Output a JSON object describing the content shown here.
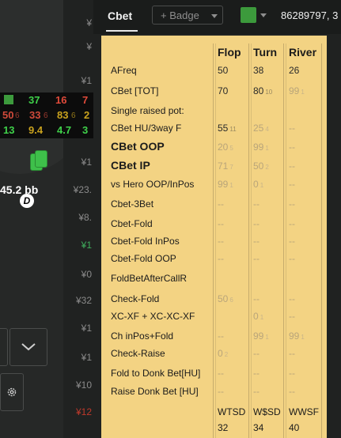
{
  "header": {
    "tab_label": "Cbet",
    "badge_label": "+ Badge",
    "player_color": "#3c9a3c",
    "player_id_text": "86289797, 3"
  },
  "background": {
    "right_values": [
      "¥",
      "¥",
      "¥1",
      "¥",
      "¥1",
      "¥23.",
      "¥8.",
      "¥1",
      "¥0",
      "¥32",
      "¥1",
      "¥1",
      "¥10",
      "¥12"
    ],
    "hud_row1": [
      "37",
      "16",
      "7"
    ],
    "hud_row2": [
      "50",
      "6",
      "33",
      "6",
      "83",
      "6",
      "2"
    ],
    "hud_row3": [
      "13",
      "9.4",
      "4.7",
      "3"
    ],
    "stack_text": "45.2 bb",
    "dealer_text": "D"
  },
  "stats": {
    "columns": [
      "Flop",
      "Turn",
      "River"
    ],
    "rows": [
      {
        "label": "AFreq",
        "big": false,
        "flop": {
          "v": "50",
          "s": "",
          "g": false
        },
        "turn": {
          "v": "38",
          "s": "",
          "g": false
        },
        "river": {
          "v": "26",
          "s": "",
          "g": false
        }
      },
      {
        "label": "CBet [TOT]",
        "big": false,
        "flop": {
          "v": "70",
          "s": "",
          "g": false
        },
        "turn": {
          "v": "80",
          "s": "10",
          "g": false
        },
        "river": {
          "v": "99",
          "s": "1",
          "g": true
        }
      },
      {
        "label": "Single raised pot:",
        "big": false,
        "flop": null,
        "turn": null,
        "river": null
      },
      {
        "label": "CBet HU/3way F",
        "big": false,
        "flop": {
          "v": "55",
          "s": "11",
          "g": false
        },
        "turn": {
          "v": "25",
          "s": "4",
          "g": true
        },
        "river": {
          "v": "--",
          "s": "",
          "g": true
        }
      },
      {
        "label": "CBet OOP",
        "big": true,
        "flop": {
          "v": "20",
          "s": "5",
          "g": true
        },
        "turn": {
          "v": "99",
          "s": "1",
          "g": true
        },
        "river": {
          "v": "--",
          "s": "",
          "g": true
        }
      },
      {
        "label": "CBet IP",
        "big": true,
        "flop": {
          "v": "71",
          "s": "7",
          "g": true
        },
        "turn": {
          "v": "50",
          "s": "2",
          "g": true
        },
        "river": {
          "v": "--",
          "s": "",
          "g": true
        }
      },
      {
        "label": "vs Hero OOP/InPos",
        "big": false,
        "flop": {
          "v": "99",
          "s": "1",
          "g": true
        },
        "turn": {
          "v": "0",
          "s": "1",
          "g": true
        },
        "river": {
          "v": "--",
          "s": "",
          "g": true
        }
      },
      {
        "label": "Cbet-3Bet",
        "big": false,
        "flop": {
          "v": "--",
          "s": "",
          "g": true
        },
        "turn": {
          "v": "--",
          "s": "",
          "g": true
        },
        "river": {
          "v": "--",
          "s": "",
          "g": true
        }
      },
      {
        "label": "Cbet-Fold",
        "big": false,
        "flop": {
          "v": "--",
          "s": "",
          "g": true
        },
        "turn": {
          "v": "--",
          "s": "",
          "g": true
        },
        "river": {
          "v": "--",
          "s": "",
          "g": true
        }
      },
      {
        "label": "Cbet-Fold InPos",
        "big": false,
        "flop": {
          "v": "--",
          "s": "",
          "g": true
        },
        "turn": {
          "v": "--",
          "s": "",
          "g": true
        },
        "river": {
          "v": "--",
          "s": "",
          "g": true
        }
      },
      {
        "label": "Cbet-Fold OOP",
        "big": false,
        "flop": {
          "v": "--",
          "s": "",
          "g": true
        },
        "turn": {
          "v": "--",
          "s": "",
          "g": true
        },
        "river": {
          "v": "--",
          "s": "",
          "g": true
        }
      },
      {
        "label": "FoldBetAfterCallR",
        "big": false,
        "flop": null,
        "turn": null,
        "river": null
      },
      {
        "label": "Check-Fold",
        "big": false,
        "flop": {
          "v": "50",
          "s": "6",
          "g": true
        },
        "turn": {
          "v": "--",
          "s": "",
          "g": true
        },
        "river": {
          "v": "--",
          "s": "",
          "g": true
        }
      },
      {
        "label": "XC-XF + XC-XC-XF",
        "big": false,
        "flop": null,
        "turn": {
          "v": "0",
          "s": "1",
          "g": true
        },
        "river": {
          "v": "--",
          "s": "",
          "g": true
        }
      },
      {
        "label": "Ch inPos+Fold",
        "big": false,
        "flop": {
          "v": "--",
          "s": "",
          "g": true
        },
        "turn": {
          "v": "99",
          "s": "1",
          "g": true
        },
        "river": {
          "v": "99",
          "s": "1",
          "g": true
        }
      },
      {
        "label": "Check-Raise",
        "big": false,
        "flop": {
          "v": "0",
          "s": "2",
          "g": true
        },
        "turn": {
          "v": "--",
          "s": "",
          "g": true
        },
        "river": {
          "v": "--",
          "s": "",
          "g": true
        }
      },
      {
        "label": "Fold to Donk Bet[HU]",
        "big": false,
        "flop": {
          "v": "--",
          "s": "",
          "g": true
        },
        "turn": {
          "v": "--",
          "s": "",
          "g": true
        },
        "river": {
          "v": "--",
          "s": "",
          "g": true
        }
      },
      {
        "label": "Raise Donk Bet [HU]",
        "big": false,
        "flop": {
          "v": "--",
          "s": "",
          "g": true
        },
        "turn": {
          "v": "--",
          "s": "",
          "g": true
        },
        "river": {
          "v": "--",
          "s": "",
          "g": true
        }
      }
    ],
    "footer_labels": [
      "WTSD",
      "W$SD",
      "WWSF"
    ],
    "footer_values": [
      "32",
      "34",
      "40"
    ]
  }
}
